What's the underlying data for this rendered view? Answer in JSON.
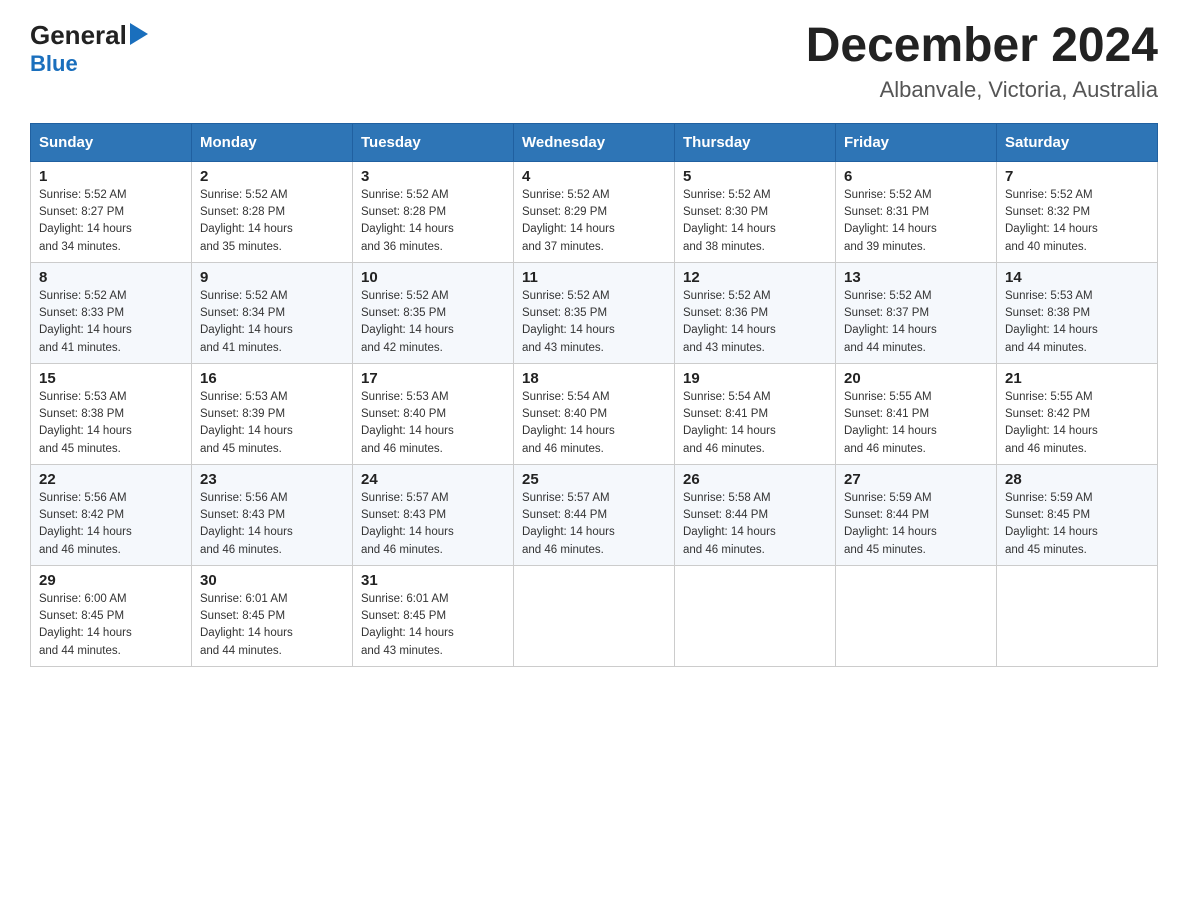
{
  "header": {
    "logo_line1": "General",
    "logo_line2": "Blue",
    "month_title": "December 2024",
    "location": "Albanvale, Victoria, Australia"
  },
  "days_of_week": [
    "Sunday",
    "Monday",
    "Tuesday",
    "Wednesday",
    "Thursday",
    "Friday",
    "Saturday"
  ],
  "weeks": [
    [
      {
        "day": "1",
        "sunrise": "5:52 AM",
        "sunset": "8:27 PM",
        "daylight": "14 hours and 34 minutes."
      },
      {
        "day": "2",
        "sunrise": "5:52 AM",
        "sunset": "8:28 PM",
        "daylight": "14 hours and 35 minutes."
      },
      {
        "day": "3",
        "sunrise": "5:52 AM",
        "sunset": "8:28 PM",
        "daylight": "14 hours and 36 minutes."
      },
      {
        "day": "4",
        "sunrise": "5:52 AM",
        "sunset": "8:29 PM",
        "daylight": "14 hours and 37 minutes."
      },
      {
        "day": "5",
        "sunrise": "5:52 AM",
        "sunset": "8:30 PM",
        "daylight": "14 hours and 38 minutes."
      },
      {
        "day": "6",
        "sunrise": "5:52 AM",
        "sunset": "8:31 PM",
        "daylight": "14 hours and 39 minutes."
      },
      {
        "day": "7",
        "sunrise": "5:52 AM",
        "sunset": "8:32 PM",
        "daylight": "14 hours and 40 minutes."
      }
    ],
    [
      {
        "day": "8",
        "sunrise": "5:52 AM",
        "sunset": "8:33 PM",
        "daylight": "14 hours and 41 minutes."
      },
      {
        "day": "9",
        "sunrise": "5:52 AM",
        "sunset": "8:34 PM",
        "daylight": "14 hours and 41 minutes."
      },
      {
        "day": "10",
        "sunrise": "5:52 AM",
        "sunset": "8:35 PM",
        "daylight": "14 hours and 42 minutes."
      },
      {
        "day": "11",
        "sunrise": "5:52 AM",
        "sunset": "8:35 PM",
        "daylight": "14 hours and 43 minutes."
      },
      {
        "day": "12",
        "sunrise": "5:52 AM",
        "sunset": "8:36 PM",
        "daylight": "14 hours and 43 minutes."
      },
      {
        "day": "13",
        "sunrise": "5:52 AM",
        "sunset": "8:37 PM",
        "daylight": "14 hours and 44 minutes."
      },
      {
        "day": "14",
        "sunrise": "5:53 AM",
        "sunset": "8:38 PM",
        "daylight": "14 hours and 44 minutes."
      }
    ],
    [
      {
        "day": "15",
        "sunrise": "5:53 AM",
        "sunset": "8:38 PM",
        "daylight": "14 hours and 45 minutes."
      },
      {
        "day": "16",
        "sunrise": "5:53 AM",
        "sunset": "8:39 PM",
        "daylight": "14 hours and 45 minutes."
      },
      {
        "day": "17",
        "sunrise": "5:53 AM",
        "sunset": "8:40 PM",
        "daylight": "14 hours and 46 minutes."
      },
      {
        "day": "18",
        "sunrise": "5:54 AM",
        "sunset": "8:40 PM",
        "daylight": "14 hours and 46 minutes."
      },
      {
        "day": "19",
        "sunrise": "5:54 AM",
        "sunset": "8:41 PM",
        "daylight": "14 hours and 46 minutes."
      },
      {
        "day": "20",
        "sunrise": "5:55 AM",
        "sunset": "8:41 PM",
        "daylight": "14 hours and 46 minutes."
      },
      {
        "day": "21",
        "sunrise": "5:55 AM",
        "sunset": "8:42 PM",
        "daylight": "14 hours and 46 minutes."
      }
    ],
    [
      {
        "day": "22",
        "sunrise": "5:56 AM",
        "sunset": "8:42 PM",
        "daylight": "14 hours and 46 minutes."
      },
      {
        "day": "23",
        "sunrise": "5:56 AM",
        "sunset": "8:43 PM",
        "daylight": "14 hours and 46 minutes."
      },
      {
        "day": "24",
        "sunrise": "5:57 AM",
        "sunset": "8:43 PM",
        "daylight": "14 hours and 46 minutes."
      },
      {
        "day": "25",
        "sunrise": "5:57 AM",
        "sunset": "8:44 PM",
        "daylight": "14 hours and 46 minutes."
      },
      {
        "day": "26",
        "sunrise": "5:58 AM",
        "sunset": "8:44 PM",
        "daylight": "14 hours and 46 minutes."
      },
      {
        "day": "27",
        "sunrise": "5:59 AM",
        "sunset": "8:44 PM",
        "daylight": "14 hours and 45 minutes."
      },
      {
        "day": "28",
        "sunrise": "5:59 AM",
        "sunset": "8:45 PM",
        "daylight": "14 hours and 45 minutes."
      }
    ],
    [
      {
        "day": "29",
        "sunrise": "6:00 AM",
        "sunset": "8:45 PM",
        "daylight": "14 hours and 44 minutes."
      },
      {
        "day": "30",
        "sunrise": "6:01 AM",
        "sunset": "8:45 PM",
        "daylight": "14 hours and 44 minutes."
      },
      {
        "day": "31",
        "sunrise": "6:01 AM",
        "sunset": "8:45 PM",
        "daylight": "14 hours and 43 minutes."
      },
      null,
      null,
      null,
      null
    ]
  ],
  "labels": {
    "sunrise": "Sunrise:",
    "sunset": "Sunset:",
    "daylight": "Daylight:"
  }
}
